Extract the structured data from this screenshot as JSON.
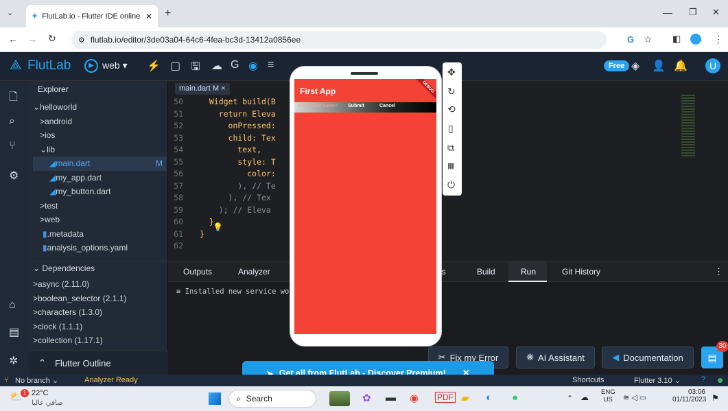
{
  "browser": {
    "tab_title": "FlutLab.io - Flutter IDE online",
    "url": "flutlab.io/editor/3de03a04-64c6-4fea-bc3d-13412a0856ee"
  },
  "header": {
    "brand": "FlutLab",
    "target": "web",
    "free_badge": "Free",
    "user_initial": "U"
  },
  "explorer": {
    "title": "Explorer",
    "items": [
      {
        "label": "helloworld",
        "prefix": "⌄"
      },
      {
        "label": "android",
        "prefix": ">"
      },
      {
        "label": "ios",
        "prefix": ">"
      },
      {
        "label": "lib",
        "prefix": "⌄"
      },
      {
        "label": "main.dart",
        "badge": "M"
      },
      {
        "label": "my_app.dart"
      },
      {
        "label": "my_button.dart"
      },
      {
        "label": "test",
        "prefix": ">"
      },
      {
        "label": "web",
        "prefix": ">"
      },
      {
        "label": ".metadata"
      },
      {
        "label": "analysis_options.yaml"
      }
    ],
    "dependencies_title": "Dependencies",
    "dependencies": [
      "async (2.11.0)",
      "boolean_selector (2.1.1)",
      "characters (1.3.0)",
      "clock (1.1.1)",
      "collection (1.17.1)"
    ],
    "outline": "Flutter Outline"
  },
  "editor": {
    "tab_label": "main.dart M",
    "lines": [
      {
        "n": "50",
        "text": "  Widget build(B"
      },
      {
        "n": "51",
        "text": "    return Eleva"
      },
      {
        "n": "52",
        "text": "      onPressed:"
      },
      {
        "n": "53",
        "text": "      child: Tex"
      },
      {
        "n": "54",
        "text": "        text,"
      },
      {
        "n": "55",
        "text": "        style: T"
      },
      {
        "n": "56",
        "text": "          color:"
      },
      {
        "n": "57",
        "text": "        ), // Te"
      },
      {
        "n": "58",
        "text": "      ), // Tex"
      },
      {
        "n": "59",
        "text": "    ); // Eleva"
      },
      {
        "n": "60",
        "text": "  }"
      },
      {
        "n": "61",
        "text": "}"
      },
      {
        "n": "62",
        "text": ""
      }
    ]
  },
  "panel": {
    "tabs_left": [
      "Outputs",
      "Analyzer"
    ],
    "tabs_right": [
      "ls",
      "Build",
      "Run",
      "Git History"
    ],
    "active_tab": "Run",
    "output_line": "≡ Installed new service wo",
    "fix_button": "Fix my Error",
    "ai_button": "AI Assistant",
    "docs_button": "Documentation",
    "chat_badge": "30"
  },
  "phone": {
    "app_title": "First App",
    "debug_ribbon": "DEBUG",
    "input_placeholder": "Put in your name?",
    "submit": "Submit",
    "cancel": "Cancel"
  },
  "promo": {
    "text": "Get all from FlutLab - Discover Premium!",
    "close": "✕"
  },
  "statusbar": {
    "branch": "No branch",
    "analyzer": "Analyzer Ready",
    "shortcuts": "Shortcuts",
    "flutter_version": "Flutter 3.10"
  },
  "taskbar": {
    "weather_temp": "22°C",
    "weather_desc": "صافي عالبا",
    "weather_badge": "1",
    "search": "Search",
    "lang_top": "ENG",
    "lang_bottom": "US",
    "time": "03:06",
    "date": "01/11/2023"
  },
  "colors": {
    "accent_red": "#f44336",
    "flutlab_blue": "#2aa3f0",
    "promo_blue": "#1d9be6"
  }
}
